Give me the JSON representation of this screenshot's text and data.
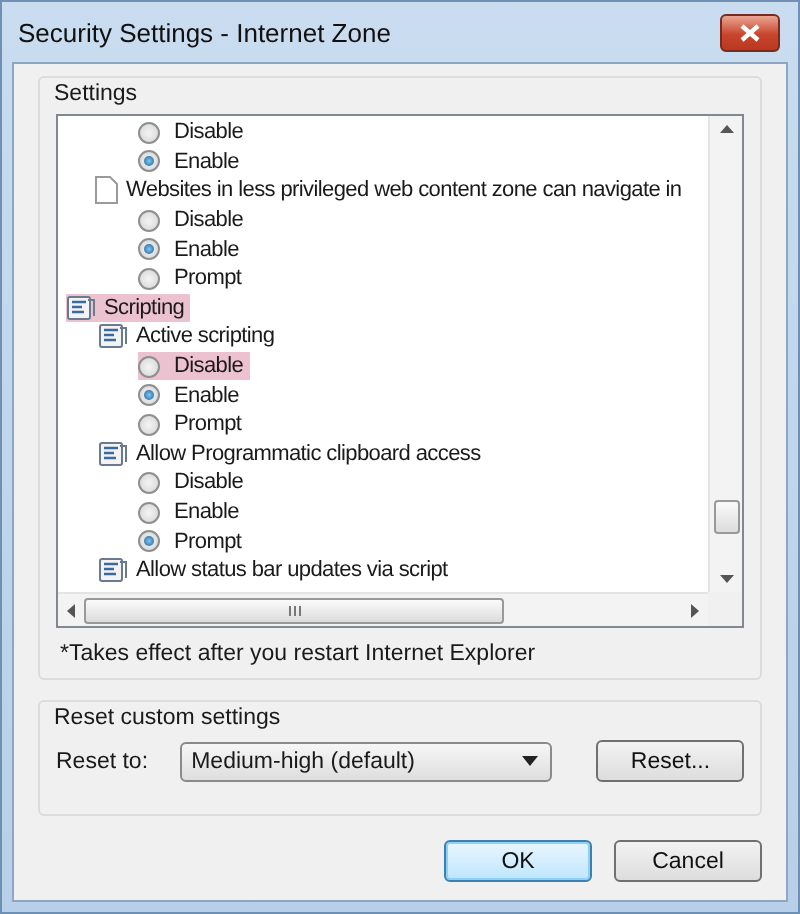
{
  "window": {
    "title": "Security Settings - Internet Zone"
  },
  "settings": {
    "title": "Settings",
    "tree": [
      {
        "kind": "option",
        "label": "Disable",
        "selected": false,
        "highlighted": false
      },
      {
        "kind": "option",
        "label": "Enable",
        "selected": true,
        "highlighted": false
      },
      {
        "kind": "document",
        "label": "Websites in less privileged web content zone can navigate in",
        "highlighted": false,
        "children": [
          {
            "kind": "option",
            "label": "Disable",
            "selected": false,
            "highlighted": false
          },
          {
            "kind": "option",
            "label": "Enable",
            "selected": true,
            "highlighted": false
          },
          {
            "kind": "option",
            "label": "Prompt",
            "selected": false,
            "highlighted": false
          }
        ]
      },
      {
        "kind": "category",
        "label": "Scripting",
        "highlighted": true,
        "children": [
          {
            "kind": "script",
            "label": "Active scripting",
            "highlighted": false,
            "children": [
              {
                "kind": "option",
                "label": "Disable",
                "selected": false,
                "highlighted": true
              },
              {
                "kind": "option",
                "label": "Enable",
                "selected": true,
                "highlighted": false
              },
              {
                "kind": "option",
                "label": "Prompt",
                "selected": false,
                "highlighted": false
              }
            ]
          },
          {
            "kind": "script",
            "label": "Allow Programmatic clipboard access",
            "highlighted": false,
            "children": [
              {
                "kind": "option",
                "label": "Disable",
                "selected": false,
                "highlighted": false
              },
              {
                "kind": "option",
                "label": "Enable",
                "selected": false,
                "highlighted": false
              },
              {
                "kind": "option",
                "label": "Prompt",
                "selected": true,
                "highlighted": false
              }
            ]
          },
          {
            "kind": "script",
            "label": "Allow status bar updates via script",
            "highlighted": false
          }
        ]
      }
    ],
    "note": "*Takes effect after you restart Internet Explorer"
  },
  "reset": {
    "title": "Reset custom settings",
    "label": "Reset to:",
    "value": "Medium-high (default)",
    "button": "Reset..."
  },
  "buttons": [
    {
      "label": "OK",
      "default": true
    },
    {
      "label": "Cancel",
      "default": false
    }
  ]
}
